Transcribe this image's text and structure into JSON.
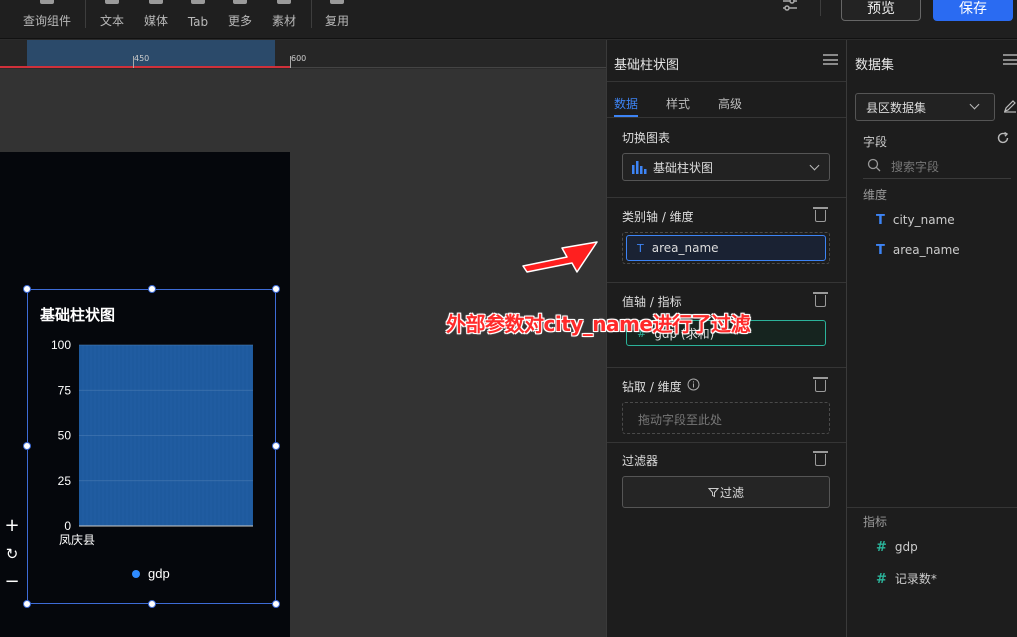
{
  "toolbar": {
    "items": [
      {
        "label": "查询组件"
      },
      {
        "label": "文本"
      },
      {
        "label": "媒体"
      },
      {
        "label": "Tab"
      },
      {
        "label": "更多"
      },
      {
        "label": "素材"
      },
      {
        "label": "复用"
      }
    ],
    "preview_label": "预览",
    "save_label": "保存",
    "accent": "#2a6bf2"
  },
  "ruler": {
    "ticks": [
      "450",
      "600"
    ]
  },
  "canvas_chart": {
    "title": "基础柱状图",
    "category": "凤庆县",
    "legend": "gdp",
    "bar_color": "#1e5a9e",
    "chart_data": {
      "type": "bar",
      "categories": [
        "凤庆县"
      ],
      "series": [
        {
          "name": "gdp",
          "values": [
            100
          ]
        }
      ],
      "yticks": [
        "100",
        "75",
        "50",
        "25",
        "0"
      ],
      "ylim": [
        0,
        100
      ],
      "legend_position": "bottom"
    }
  },
  "config_panel": {
    "title": "基础柱状图",
    "tabs": [
      {
        "label": "数据"
      },
      {
        "label": "样式"
      },
      {
        "label": "高级"
      }
    ],
    "switch_chart_label": "切换图表",
    "chart_type_value": "基础柱状图",
    "category_axis_label": "类别轴 / 维度",
    "category_field": "area_name",
    "value_axis_label": "值轴 / 指标",
    "value_field": "gdp (求和)",
    "drill_label": "钻取 / 维度",
    "drill_placeholder": "拖动字段至此处",
    "filter_section_label": "过滤器",
    "filter_button_label": "过滤"
  },
  "dataset_panel": {
    "title": "数据集",
    "dataset_value": "县区数据集",
    "fields_label": "字段",
    "search_placeholder": "搜索字段",
    "dimensions_label": "维度",
    "dimensions": [
      {
        "name": "city_name"
      },
      {
        "name": "area_name"
      }
    ],
    "measures_label": "指标",
    "measures": [
      {
        "name": "gdp"
      },
      {
        "name": "记录数*"
      }
    ]
  },
  "annotation": {
    "text": "外部参数对city_name进行了过滤",
    "color": "#ff2a2a"
  }
}
